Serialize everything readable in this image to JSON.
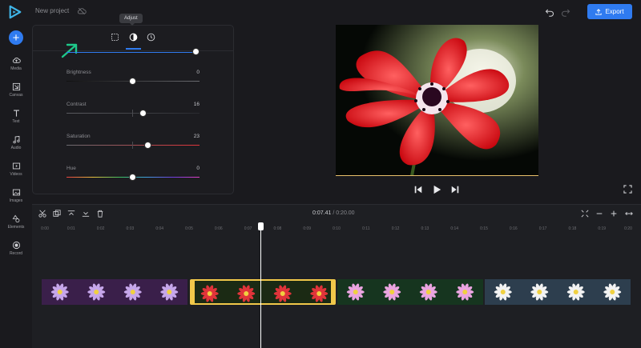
{
  "app": {
    "project_name": "New project",
    "export_label": "Export"
  },
  "sidebar": {
    "add_label": "+",
    "items": [
      {
        "label": "Media",
        "icon": "cloud-upload-icon"
      },
      {
        "label": "Canvas",
        "icon": "canvas-icon"
      },
      {
        "label": "Text",
        "icon": "text-icon"
      },
      {
        "label": "Audio",
        "icon": "music-note-icon"
      },
      {
        "label": "Videos",
        "icon": "video-icon"
      },
      {
        "label": "Images",
        "icon": "image-icon"
      },
      {
        "label": "Elements",
        "icon": "shapes-icon"
      },
      {
        "label": "Record",
        "icon": "record-icon"
      }
    ]
  },
  "adjust_panel": {
    "tooltip": "Adjust",
    "tabs": [
      {
        "icon": "crop-icon"
      },
      {
        "icon": "adjust-contrast-icon",
        "active": true
      },
      {
        "icon": "clock-icon"
      }
    ],
    "controls": [
      {
        "label": "Brightness",
        "value": 0
      },
      {
        "label": "Contrast",
        "value": 16
      },
      {
        "label": "Saturation",
        "value": 23
      },
      {
        "label": "Hue",
        "value": 0
      }
    ]
  },
  "player": {
    "controls": [
      "skip-back-icon",
      "play-icon",
      "skip-forward-icon",
      "fullscreen-icon"
    ]
  },
  "timeline": {
    "current_time": "0:07.41",
    "separator": "/",
    "total_time": "0:20.00",
    "ruler_labels": [
      "0:00",
      "0:01",
      "0:02",
      "0:03",
      "0:04",
      "0:05",
      "0:06",
      "0:07",
      "0:08",
      "0:09",
      "0:10",
      "0:11",
      "0:12",
      "0:13",
      "0:14",
      "0:15",
      "0:16",
      "0:17",
      "0:18",
      "0:19",
      "0:20"
    ],
    "playhead_time": 7.41,
    "clips": [
      {
        "name": "purple-flowers-clip",
        "start": 0,
        "end": 5,
        "selected": false,
        "bg": "#3a1f4a",
        "flower": "#c6a6ea"
      },
      {
        "name": "red-anemone-clip",
        "start": 5,
        "end": 10,
        "selected": true,
        "bg": "#1b2a14",
        "flower": "#e0343a"
      },
      {
        "name": "pink-lotus-clip",
        "start": 10,
        "end": 15,
        "selected": false,
        "bg": "#16351f",
        "flower": "#eaa4e0"
      },
      {
        "name": "white-daisy-clip",
        "start": 15,
        "end": 20,
        "selected": false,
        "bg": "#2d3e4e",
        "flower": "#f2f2f2"
      }
    ],
    "tools": [
      "scissors-icon",
      "duplicate-icon",
      "align-top-icon",
      "align-bottom-icon",
      "trash-icon"
    ],
    "zoom_tools": [
      "fit-icon",
      "zoom-out-icon",
      "zoom-in-icon",
      "expand-icon"
    ]
  },
  "colors": {
    "accent": "#2f7bf0",
    "selection": "#f1c84a",
    "background": "#1a1a1e"
  }
}
